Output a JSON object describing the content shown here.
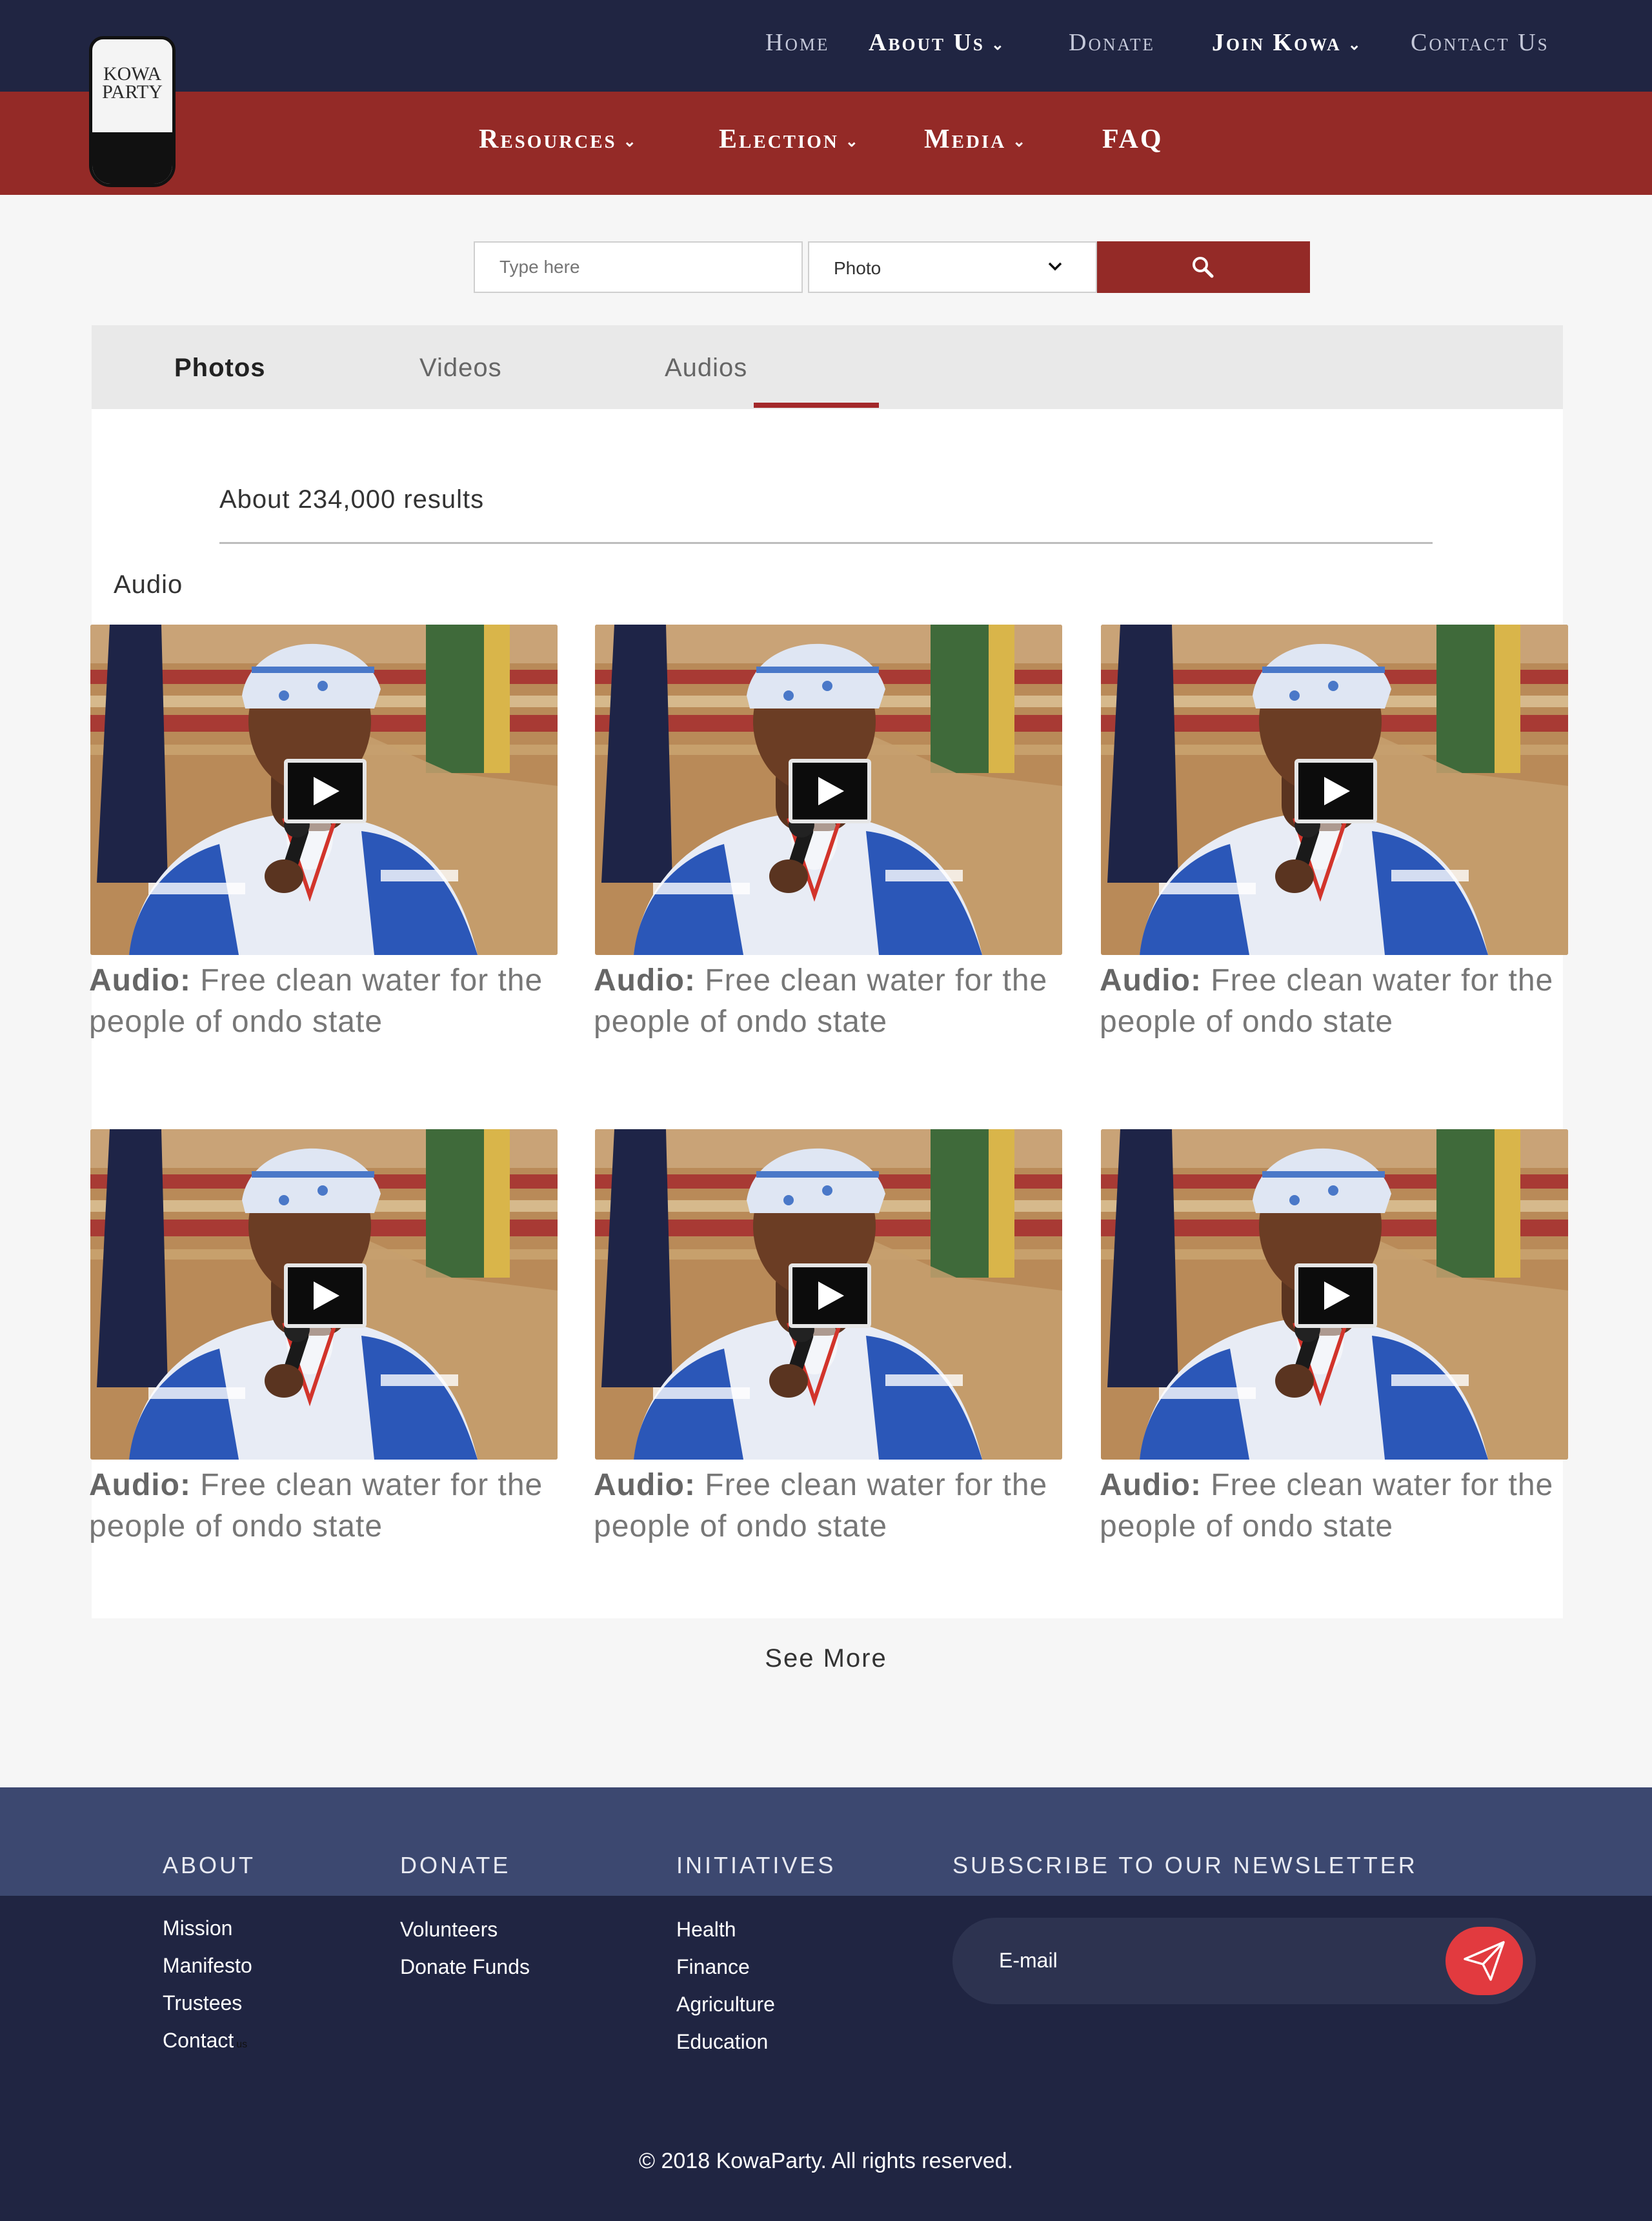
{
  "header": {
    "logo_text_1": "KOWA",
    "logo_text_2": "PARTY",
    "top_nav": [
      {
        "label": "Home"
      },
      {
        "label": "About Us"
      },
      {
        "label": "Donate"
      },
      {
        "label": "Join Kowa"
      },
      {
        "label": "Contact Us"
      }
    ],
    "main_nav": [
      {
        "label": "Resources"
      },
      {
        "label": "Election"
      },
      {
        "label": "Media"
      },
      {
        "label": "FAQ"
      }
    ]
  },
  "search": {
    "placeholder": "Type here",
    "select_value": "Photo",
    "icons": {
      "select": "chevron-down-icon",
      "button": "search-icon"
    }
  },
  "tabs": [
    {
      "label": "Photos",
      "active": true
    },
    {
      "label": "Videos",
      "active": false
    },
    {
      "label": "Audios",
      "active": false,
      "underlined": true
    }
  ],
  "results_text": "About 234,000 results",
  "section_title": "Audio",
  "items": [
    {
      "prefix": "Audio:",
      "title": "Free clean water for the people of ondo state"
    },
    {
      "prefix": "Audio:",
      "title": "Free clean water for the people of ondo state"
    },
    {
      "prefix": "Audio:",
      "title": "Free clean water for the people of ondo state"
    },
    {
      "prefix": "Audio:",
      "title": "Free clean water for the people of ondo state"
    },
    {
      "prefix": "Audio:",
      "title": "Free clean water for the people of ondo state"
    },
    {
      "prefix": "Audio:",
      "title": "Free clean water for the people of ondo state"
    }
  ],
  "see_more": "See More",
  "footer": {
    "about": {
      "heading": "ABOUT",
      "links": [
        "Mission",
        "Manifesto",
        "Trustees",
        "Contact"
      ],
      "contact_suffix": "us"
    },
    "donate": {
      "heading": "DONATE",
      "links": [
        "Volunteers",
        "Donate Funds"
      ]
    },
    "initiatives": {
      "heading": "INITIATIVES",
      "links": [
        "Health",
        "Finance",
        "Agriculture",
        "Education"
      ]
    },
    "newsletter": {
      "heading": "SUBSCRIBE TO OUR NEWSLETTER",
      "placeholder": "E-mail",
      "button_icon": "send-icon"
    },
    "copyright": "© 2018 KowaParty. All rights reserved."
  },
  "colors": {
    "navy": "#202542",
    "brand_red": "#942a27",
    "footer_band": "#3c4870",
    "send_button": "#e23a3f"
  }
}
